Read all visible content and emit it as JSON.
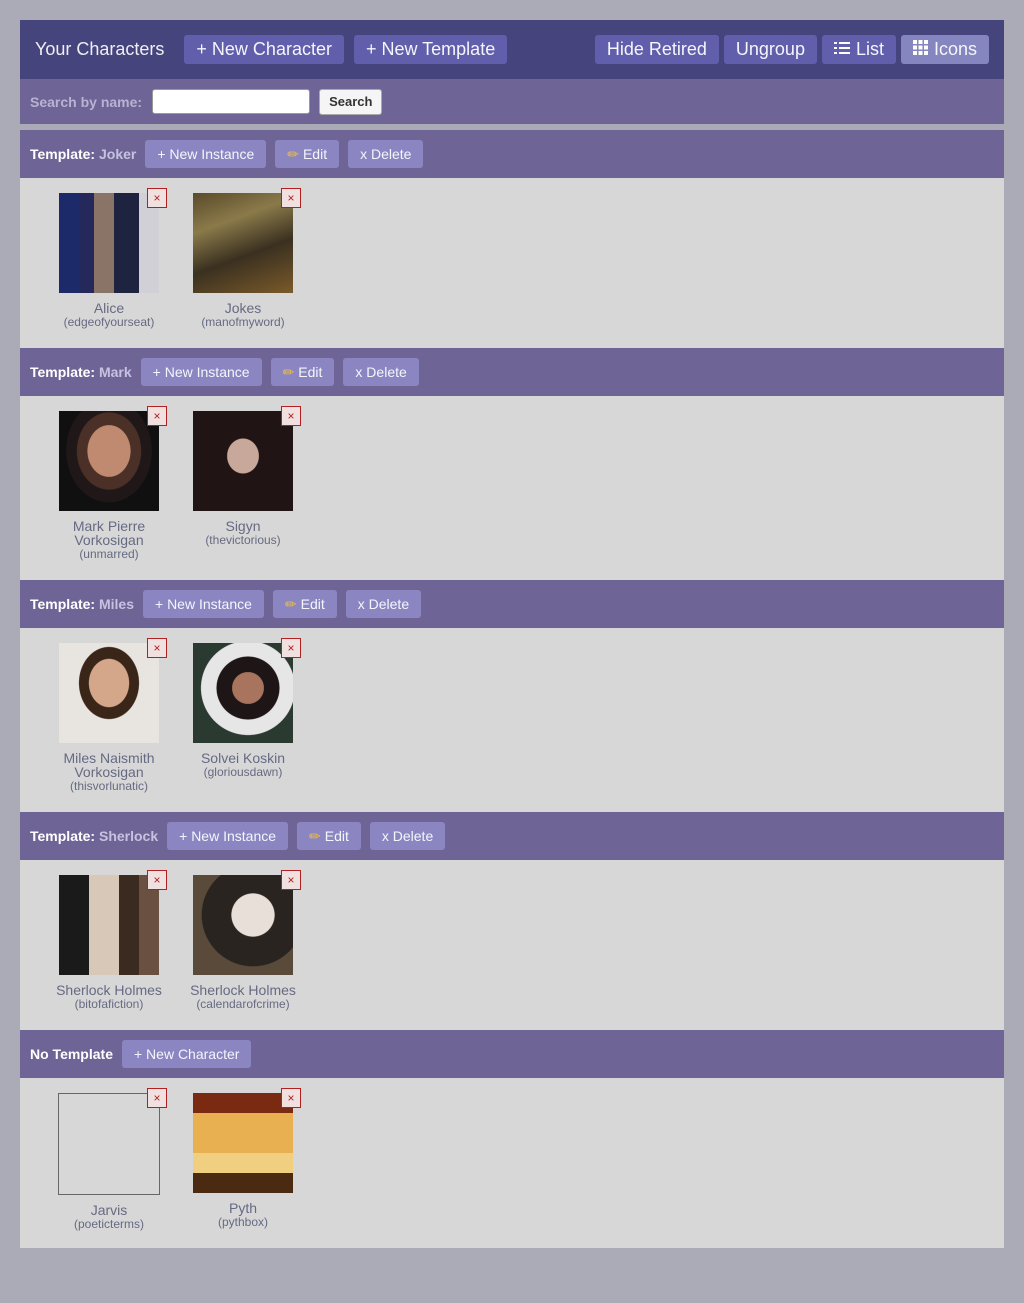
{
  "header": {
    "title": "Your Characters",
    "new_character": "+ New Character",
    "new_template": "+ New Template",
    "hide_retired": "Hide Retired",
    "ungroup": "Ungroup",
    "list": "List",
    "icons": "Icons",
    "active_view": "Icons"
  },
  "search": {
    "label": "Search by name:",
    "value": "",
    "button": "Search"
  },
  "labels": {
    "template_prefix": "Template:",
    "new_instance": "+ New Instance",
    "edit": "Edit",
    "delete": "x Delete",
    "no_template": "No Template",
    "new_character": "+ New Character",
    "remove_glyph": "×"
  },
  "groups": [
    {
      "name": "Joker",
      "characters": [
        {
          "name": "Alice",
          "user": "(edgeofyourseat)"
        },
        {
          "name": "Jokes",
          "user": "(manofmyword)"
        }
      ]
    },
    {
      "name": "Mark",
      "characters": [
        {
          "name": "Mark Pierre Vorkosigan",
          "user": "(unmarred)"
        },
        {
          "name": "Sigyn",
          "user": "(thevictorious)"
        }
      ]
    },
    {
      "name": "Miles",
      "characters": [
        {
          "name": "Miles Naismith Vorkosigan",
          "user": "(thisvorlunatic)"
        },
        {
          "name": "Solvei Koskin",
          "user": "(gloriousdawn)"
        }
      ]
    },
    {
      "name": "Sherlock",
      "characters": [
        {
          "name": "Sherlock Holmes",
          "user": "(bitofafiction)"
        },
        {
          "name": "Sherlock Holmes",
          "user": "(calendarofcrime)"
        }
      ]
    }
  ],
  "no_template": {
    "characters": [
      {
        "name": "Jarvis",
        "user": "(poeticterms)"
      },
      {
        "name": "Pyth",
        "user": "(pythbox)"
      }
    ]
  }
}
